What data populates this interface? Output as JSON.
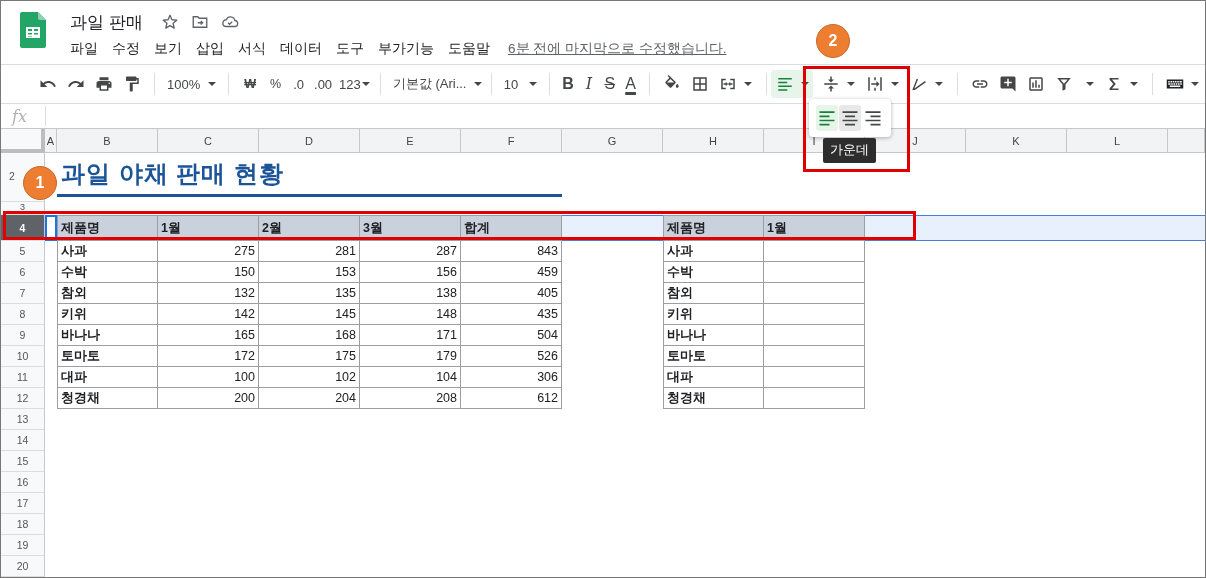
{
  "document": {
    "title": "과일 판매",
    "menu": [
      "파일",
      "수정",
      "보기",
      "삽입",
      "서식",
      "데이터",
      "도구",
      "부가기능",
      "도움말"
    ],
    "last_edit": "6분 전에 마지막으로 수정했습니다."
  },
  "toolbar": {
    "zoom": "100%",
    "currency": "₩",
    "percent": "%",
    "decimal_decrease": ".0",
    "decimal_increase": ".00",
    "number_format": "123",
    "font": "기본값 (Ari...",
    "font_size": "10",
    "format_buttons": [
      "B",
      "I",
      "S",
      "A"
    ]
  },
  "formula_bar": {
    "label": "fx"
  },
  "sheet": {
    "columns": [
      "A",
      "B",
      "C",
      "D",
      "E",
      "F",
      "G",
      "H",
      "I",
      "J",
      "K",
      "L"
    ],
    "rows": [
      {
        "number": "2",
        "selected": false
      },
      {
        "number": "3",
        "selected": false
      },
      {
        "number": "4",
        "selected": true
      },
      {
        "number": "5",
        "selected": false
      },
      {
        "number": "6",
        "selected": false
      },
      {
        "number": "7",
        "selected": false
      },
      {
        "number": "8",
        "selected": false
      },
      {
        "number": "9",
        "selected": false
      },
      {
        "number": "10",
        "selected": false
      },
      {
        "number": "11",
        "selected": false
      },
      {
        "number": "12",
        "selected": false
      },
      {
        "number": "13",
        "selected": false
      },
      {
        "number": "14",
        "selected": false
      },
      {
        "number": "15",
        "selected": false
      },
      {
        "number": "16",
        "selected": false
      },
      {
        "number": "17",
        "selected": false
      },
      {
        "number": "18",
        "selected": false
      },
      {
        "number": "19",
        "selected": false
      },
      {
        "number": "20",
        "selected": false
      }
    ],
    "title": "과일 야채 판매 현황",
    "table1": {
      "header": [
        "제품명",
        "1월",
        "2월",
        "3월",
        "합계"
      ],
      "rows": [
        [
          "사과",
          "275",
          "281",
          "287",
          "843"
        ],
        [
          "수박",
          "150",
          "153",
          "156",
          "459"
        ],
        [
          "참외",
          "132",
          "135",
          "138",
          "405"
        ],
        [
          "키위",
          "142",
          "145",
          "148",
          "435"
        ],
        [
          "바나나",
          "165",
          "168",
          "171",
          "504"
        ],
        [
          "토마토",
          "172",
          "175",
          "179",
          "526"
        ],
        [
          "대파",
          "100",
          "102",
          "104",
          "306"
        ],
        [
          "청경채",
          "200",
          "204",
          "208",
          "612"
        ]
      ]
    },
    "table2": {
      "header": [
        "제품명",
        "1월"
      ],
      "names": [
        "사과",
        "수박",
        "참외",
        "키위",
        "바나나",
        "토마토",
        "대파",
        "청경채"
      ]
    }
  },
  "align_menu": {
    "options": [
      {
        "kind": "left",
        "selected": true,
        "hovered": false
      },
      {
        "kind": "center",
        "selected": false,
        "hovered": true
      },
      {
        "kind": "right",
        "selected": false,
        "hovered": false
      }
    ],
    "tooltip": "가운데"
  },
  "annotations": [
    {
      "label": "1"
    },
    {
      "label": "2"
    }
  ]
}
